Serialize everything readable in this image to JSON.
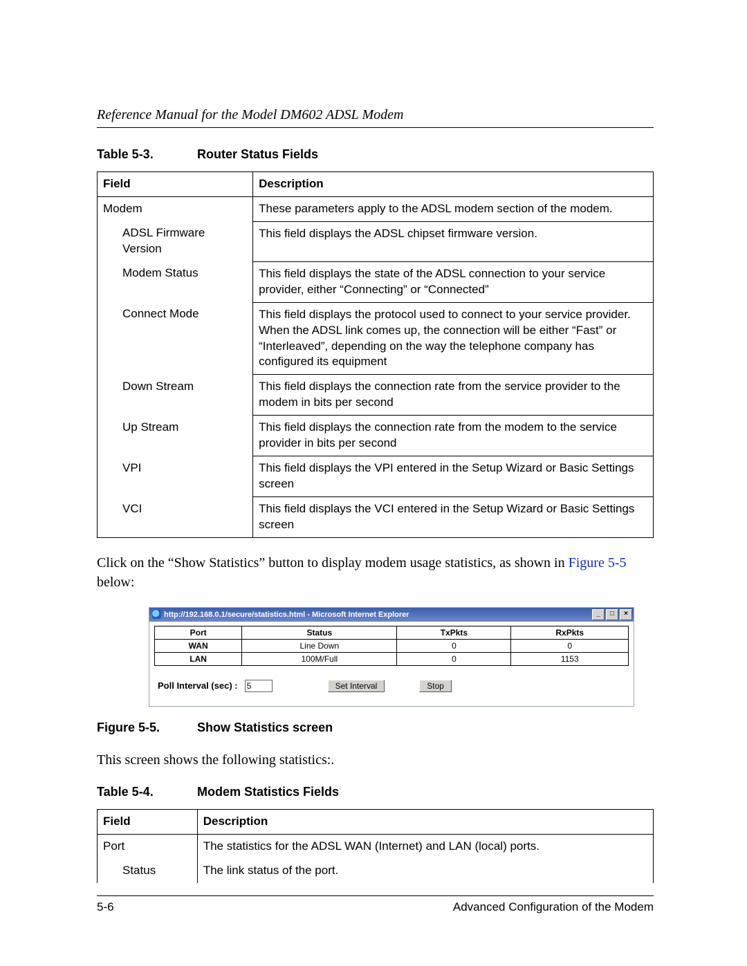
{
  "header": {
    "title": "Reference Manual for the Model DM602 ADSL Modem"
  },
  "table53": {
    "number": "Table 5-3.",
    "title": "Router Status Fields",
    "head": {
      "field": "Field",
      "desc": "Description"
    },
    "rows": {
      "modem": {
        "field": "Modem",
        "desc": "These parameters apply to the ADSL modem section of the modem."
      },
      "adslfw": {
        "field": "ADSL Firmware Version",
        "desc": "This field displays the ADSL chipset firmware version."
      },
      "mstatus": {
        "field": "Modem Status",
        "desc": "This field displays the state of the ADSL connection to your service provider, either “Connecting” or “Connected”"
      },
      "cmode": {
        "field": "Connect Mode",
        "desc": "This field displays the protocol used to connect to your service provider. When the ADSL link comes up, the connection will be either “Fast” or “Interleaved”, depending on the way the telephone company has configured its equipment"
      },
      "down": {
        "field": "Down Stream",
        "desc": "This field displays the connection rate from the service provider to the modem in bits per second"
      },
      "up": {
        "field": "Up Stream",
        "desc": "This field displays the connection rate from the modem to the service provider in bits per second"
      },
      "vpi": {
        "field": "VPI",
        "desc": "This field displays the VPI entered in the Setup Wizard or Basic Settings screen"
      },
      "vci": {
        "field": "VCI",
        "desc": "This field displays the VCI entered in the Setup Wizard or Basic Settings screen"
      }
    }
  },
  "p1_a": "Click on the “Show Statistics” button to display modem usage statistics, as shown in ",
  "p1_ref": "Figure 5-5",
  "p1_b": " below:",
  "shot": {
    "title": "http://192.168.0.1/secure/statistics.html - Microsoft Internet Explorer",
    "winbtns": {
      "min": "_",
      "max": "□",
      "close": "×"
    },
    "stats": {
      "head": {
        "port": "Port",
        "status": "Status",
        "tx": "TxPkts",
        "rx": "RxPkts"
      },
      "wan": {
        "port": "WAN",
        "status": "Line Down",
        "tx": "0",
        "rx": "0"
      },
      "lan": {
        "port": "LAN",
        "status": "100M/Full",
        "tx": "0",
        "rx": "1153"
      }
    },
    "poll": {
      "label": "Poll Interval (sec) :",
      "value": "5",
      "set": "Set Interval",
      "stop": "Stop"
    }
  },
  "fig55": {
    "number": "Figure 5-5.",
    "title": "Show Statistics screen"
  },
  "p2": "This screen shows the following statistics:.",
  "table54": {
    "number": "Table 5-4.",
    "title": "Modem Statistics Fields",
    "head": {
      "field": "Field",
      "desc": "Description"
    },
    "rows": {
      "port": {
        "field": "Port",
        "desc": "The statistics for the ADSL WAN (Internet) and LAN (local) ports."
      },
      "status": {
        "field": "Status",
        "desc": "The link status of the port."
      }
    }
  },
  "footer": {
    "left": "5-6",
    "right": "Advanced Configuration of the Modem"
  }
}
